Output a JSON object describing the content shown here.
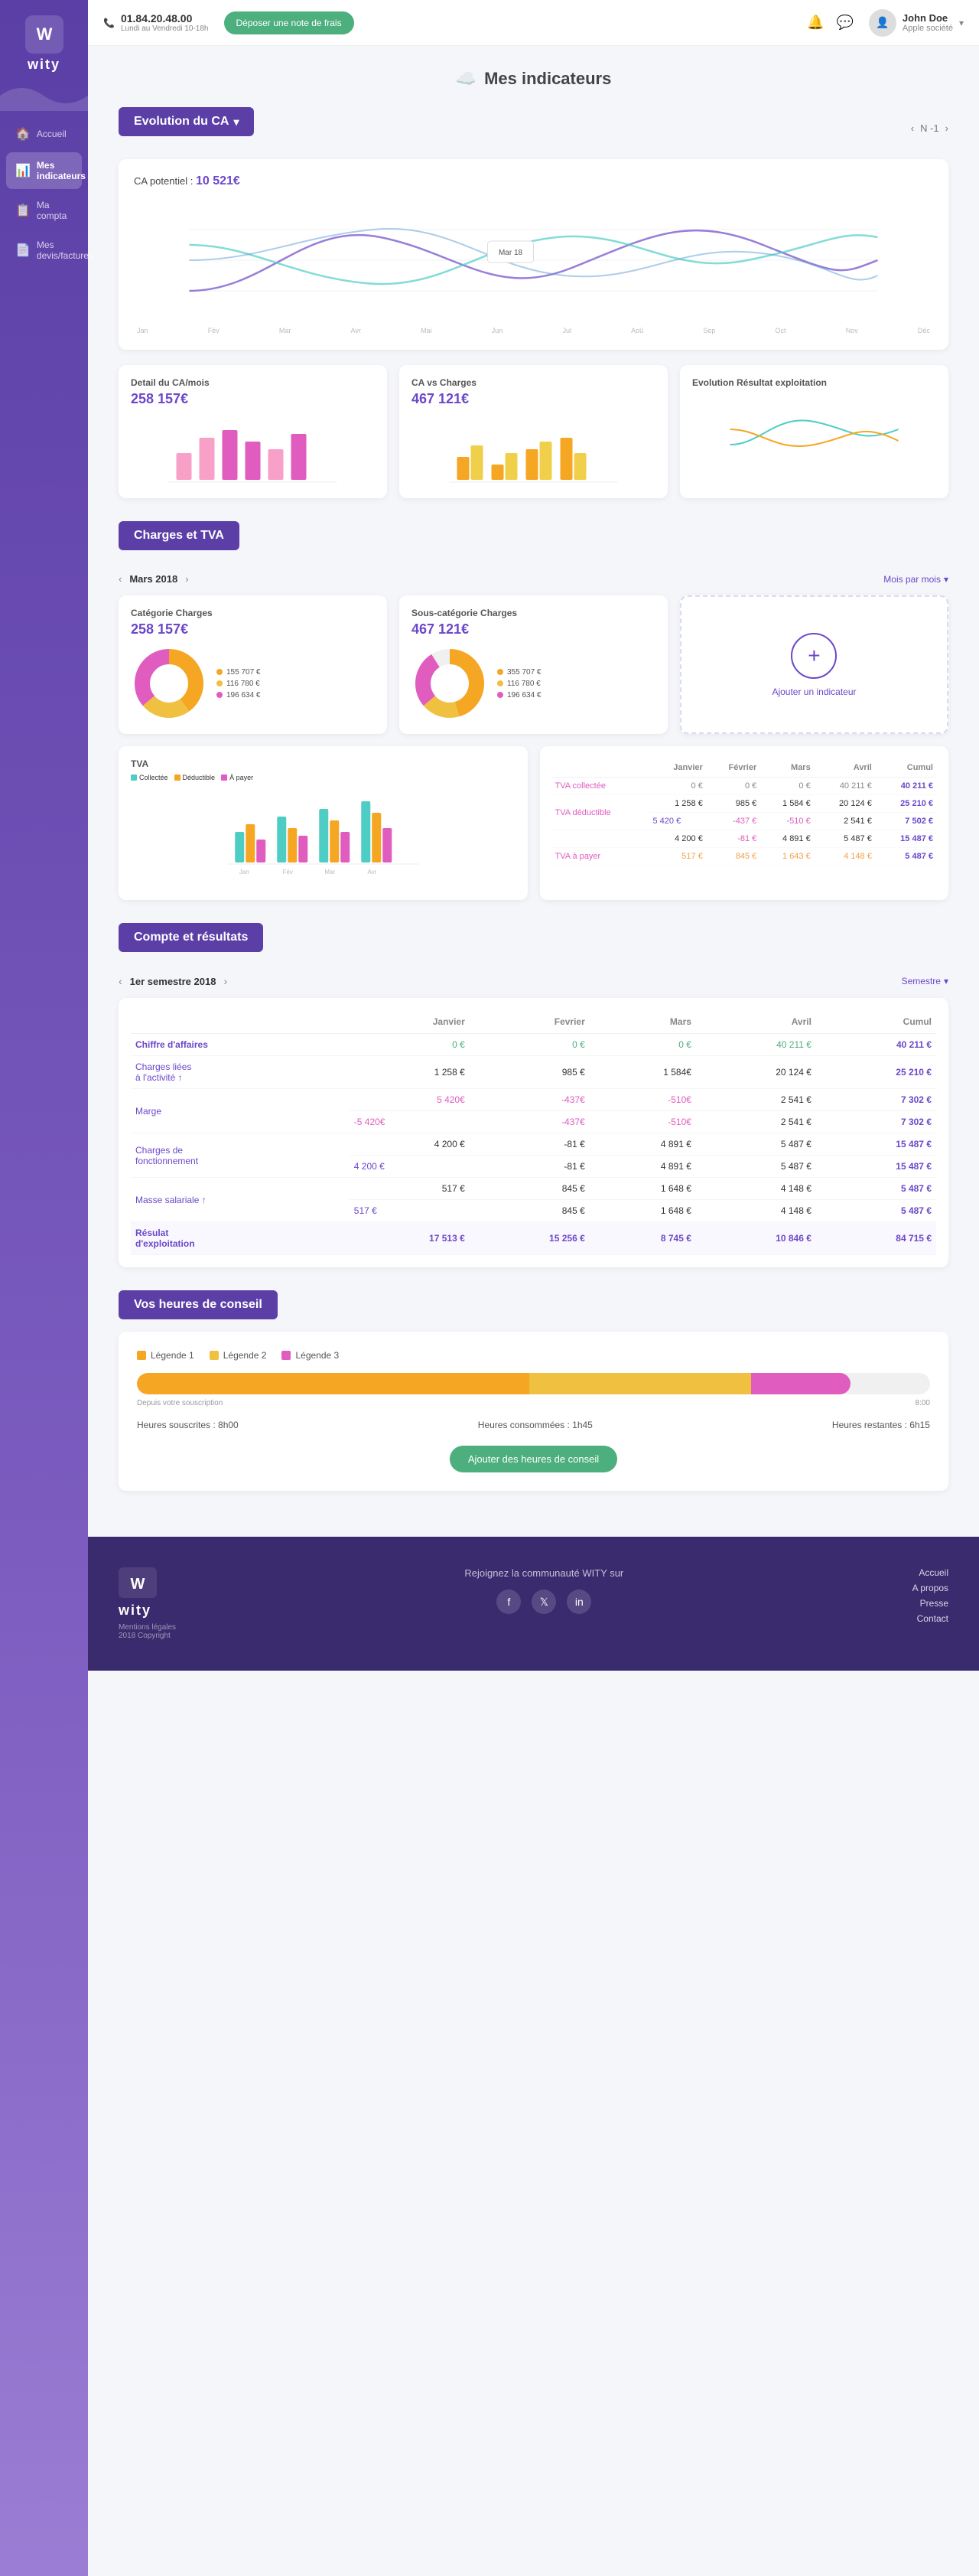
{
  "sidebar": {
    "logo_text": "wity",
    "items": [
      {
        "id": "accueil",
        "label": "Accueil",
        "icon": "🏠"
      },
      {
        "id": "indicateurs",
        "label": "Mes indicateurs",
        "icon": "📊",
        "active": true
      },
      {
        "id": "compta",
        "label": "Ma compta",
        "icon": "📋"
      },
      {
        "id": "devis",
        "label": "Mes devis/factures",
        "icon": "📄"
      }
    ]
  },
  "topbar": {
    "phone": "01.84.20.48.00",
    "hours": "Lundi au Vendredi 10-18h",
    "deposit_label": "Déposer une note de frais",
    "user_name": "John Doe",
    "user_company": "Apple société"
  },
  "page": {
    "title": "Mes indicateurs",
    "title_icon": "☁️"
  },
  "evolution_ca": {
    "section_title": "Evolution du CA",
    "nav_label": "N -1",
    "chart_ca_label": "CA potentiel :",
    "chart_ca_value": "10 521€"
  },
  "mini_cards": [
    {
      "title": "Detail du CA/mois",
      "value": "258 157€"
    },
    {
      "title": "CA vs Charges",
      "value": "467 121€"
    },
    {
      "title": "Evolution Résultat exploitation",
      "value": ""
    }
  ],
  "charges_tva": {
    "section_title": "Charges et TVA",
    "month_label": "Mars 2018",
    "mois_btn": "Mois par mois",
    "cards": [
      {
        "title": "Catégorie Charges",
        "value": "258 157€",
        "legend": [
          {
            "color": "#f5a623",
            "label": "155 707 €"
          },
          {
            "color": "#f0c040",
            "label": "116 780 €"
          },
          {
            "color": "#e05cbf",
            "label": "196 634 €"
          }
        ]
      },
      {
        "title": "Sous-catégorie Charges",
        "value": "467 121€",
        "legend": [
          {
            "color": "#f5a623",
            "label": "355 707 €"
          },
          {
            "color": "#f0c040",
            "label": "116 780 €"
          },
          {
            "color": "#e05cbf",
            "label": "196 634 €"
          }
        ]
      },
      {
        "title": "Ajouter un indicateur",
        "value": ""
      }
    ],
    "tva_table": {
      "headers": [
        "",
        "Janvier",
        "Février",
        "Mars",
        "Avril",
        "Cumul"
      ],
      "rows": [
        {
          "label": "TVA collectée",
          "values": [
            "0 €",
            "0 €",
            "0 €",
            "40 211 €",
            "40 211 €"
          ],
          "value_classes": [
            "td-gray",
            "td-gray",
            "td-gray",
            "td-gray",
            "td-purple"
          ]
        },
        {
          "label": "TVA déductible",
          "sub_values": [
            [
              "1 258 €",
              "985 €",
              "1 584 €",
              "20 124 €",
              "25 210 €"
            ],
            [
              "5 420 €",
              "-437 €",
              "-510 €",
              "2 541 €",
              "7 502 €"
            ]
          ],
          "value_classes": [
            "td-gray",
            "td-gray",
            "td-gray",
            "td-gray",
            "td-purple"
          ]
        },
        {
          "label": "",
          "sub_values": [
            [
              "4 200 €",
              "-81 €",
              "4 891 €",
              "5 487 €",
              "15 487 €"
            ]
          ]
        },
        {
          "label": "TVA à payer",
          "values": [
            "517 €",
            "845 €",
            "1 643 €",
            "4 148 €",
            "5 487 €"
          ],
          "value_classes": [
            "td-orange",
            "td-orange",
            "td-orange",
            "td-orange",
            "td-purple"
          ]
        }
      ]
    }
  },
  "compte_resultats": {
    "section_title": "Compte et résultats",
    "period_label": "1er semestre 2018",
    "semestre_btn": "Semestre",
    "headers": [
      "",
      "Janvier",
      "Fevrier",
      "Mars",
      "Avril",
      "Cumul"
    ],
    "rows": [
      {
        "label": "Chiffre d'affaires",
        "values": [
          "0 €",
          "0 €",
          "0 €",
          "40 211 €",
          "40 211 €"
        ],
        "classes": [
          "td-green",
          "td-green",
          "td-green",
          "td-green",
          "td-purple"
        ]
      },
      {
        "label": "Charges liées à l'activité ↑",
        "values": [
          "1 258 €",
          "985 €",
          "1 584€",
          "20 124 €",
          "25 210 €"
        ],
        "classes": [
          "",
          "",
          "",
          "",
          "td-purple"
        ]
      },
      {
        "label": "Marge",
        "sub_values": [
          {
            "vals": [
              "5 420€",
              "-437€",
              "-510€",
              "2 541 €",
              "7 302 €"
            ],
            "classes": [
              "td-pink",
              "td-pink",
              "td-pink",
              "td-pink",
              "td-purple"
            ]
          },
          {
            "vals": [
              "-5 420€",
              "-437€",
              "-510€",
              "2 541 €",
              "7 302 €"
            ],
            "classes": [
              "td-pink",
              "td-pink",
              "td-pink",
              "td-pink",
              "td-purple"
            ]
          }
        ]
      },
      {
        "label": "Charges de fonctionnement",
        "sub_values": [
          {
            "vals": [
              "4 200 €",
              "-81 €",
              "4 891 €",
              "5 487 €",
              "15 487 €"
            ],
            "classes": [
              "",
              "",
              "",
              "",
              "td-purple"
            ]
          },
          {
            "vals": [
              "4 200 €",
              "-81 €",
              "4 891 €",
              "5 487 €",
              "15 487 €"
            ],
            "classes": [
              "",
              "",
              "",
              "",
              "td-purple"
            ]
          }
        ]
      },
      {
        "label": "Masse salariale ↑",
        "sub_values": [
          {
            "vals": [
              "517 €",
              "845 €",
              "1 648 €",
              "4 148 €",
              "5 487 €"
            ],
            "classes": [
              "",
              "",
              "",
              "",
              "td-purple"
            ]
          },
          {
            "vals": [
              "517 €",
              "845 €",
              "1 648 €",
              "4 148 €",
              "5 487 €"
            ],
            "classes": [
              "",
              "",
              "",
              "",
              "td-purple"
            ]
          }
        ]
      },
      {
        "label": "Résulat d'exploitation",
        "values": [
          "17 513 €",
          "15 256 €",
          "8 745 €",
          "10 846 €",
          "84 715 €"
        ],
        "classes": [
          "td-purple",
          "td-purple",
          "td-purple",
          "td-purple",
          "td-purple"
        ]
      }
    ]
  },
  "conseil": {
    "section_title": "Vos heures de conseil",
    "legends": [
      {
        "color": "#f5a623",
        "label": "Légende 1"
      },
      {
        "color": "#f0c040",
        "label": "Légende 2"
      },
      {
        "color": "#e05cbf",
        "label": "Légende 3"
      }
    ],
    "progress": [
      {
        "color": "#f5a623",
        "width": 50
      },
      {
        "color": "#f0c040",
        "width": 28
      },
      {
        "color": "#e05cbf",
        "width": 12
      }
    ],
    "progress_start": "Depuis votre souscription",
    "progress_end": "8:00",
    "stats": [
      {
        "label": "Heures souscrites : 8h00"
      },
      {
        "label": "Heures consommées : 1h45"
      },
      {
        "label": "Heures restantes : 6h15"
      }
    ],
    "btn_label": "Ajouter des heures de conseil"
  },
  "footer": {
    "logo_text": "wity",
    "copyright": "Mentions légales\n2018 Copyright",
    "community_text": "Rejoignez la communauté WITY sur",
    "links": [
      "Accueil",
      "A propos",
      "Presse",
      "Contact"
    ]
  }
}
